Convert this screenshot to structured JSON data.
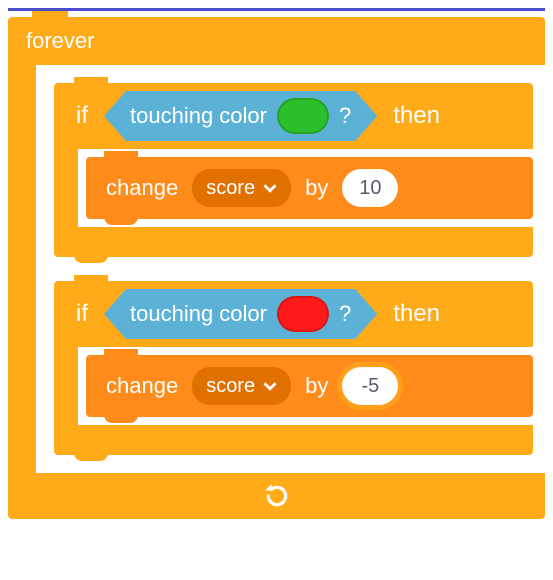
{
  "colors": {
    "control": "#ffab19",
    "data": "#ff8c1a",
    "sensing": "#5cb1d6",
    "swatch_green": "#2bbf2b",
    "swatch_red": "#ff1a1a"
  },
  "forever": {
    "label": "forever"
  },
  "if1": {
    "if_label": "if",
    "then_label": "then",
    "condition": {
      "label_prefix": "touching color",
      "label_suffix": "?",
      "color": "#2bbf2b"
    },
    "action": {
      "change_label": "change",
      "variable": "score",
      "by_label": "by",
      "value": "10",
      "value_focused": false
    }
  },
  "if2": {
    "if_label": "if",
    "then_label": "then",
    "condition": {
      "label_prefix": "touching color",
      "label_suffix": "?",
      "color": "#ff1a1a"
    },
    "action": {
      "change_label": "change",
      "variable": "score",
      "by_label": "by",
      "value": "-5",
      "value_focused": true
    }
  }
}
